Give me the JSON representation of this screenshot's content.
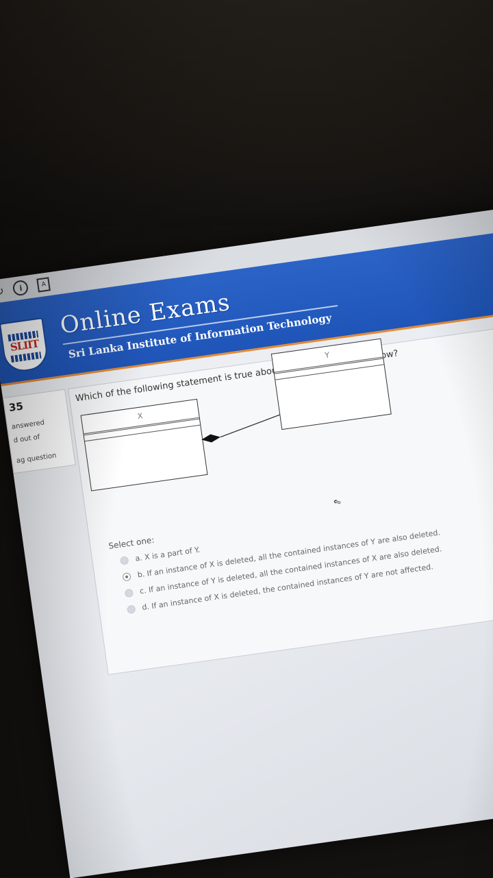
{
  "browser": {
    "close_label": "×",
    "info_label": "i",
    "pdf_label": "A"
  },
  "header": {
    "logo_text": "SLIIT",
    "title": "Online Exams",
    "subtitle": "Sri Lanka Institute of Information Technology"
  },
  "sidebar": {
    "question_number": "35",
    "status": "answered",
    "marks": "d out of",
    "flag": "ag question"
  },
  "question": {
    "text": "Which of the following statement is true about the diagram given below?",
    "diagram": {
      "class_x": "X",
      "class_y": "Y"
    },
    "prompt": "Select one:",
    "options": [
      {
        "label": "a. X is a part of Y.",
        "selected": false
      },
      {
        "label": "b. If an instance of X is deleted, all the contained instances of Y are also deleted.",
        "selected": true
      },
      {
        "label": "c. If an instance of Y is deleted, all the contained instances of X are also deleted.",
        "selected": false
      },
      {
        "label": "d. If an instance of X is deleted, the contained instances of Y are not affected.",
        "selected": false
      }
    ]
  },
  "colors": {
    "banner_blue": "#2b63c7",
    "accent_orange": "#e58a33",
    "logo_red": "#c5281f"
  }
}
